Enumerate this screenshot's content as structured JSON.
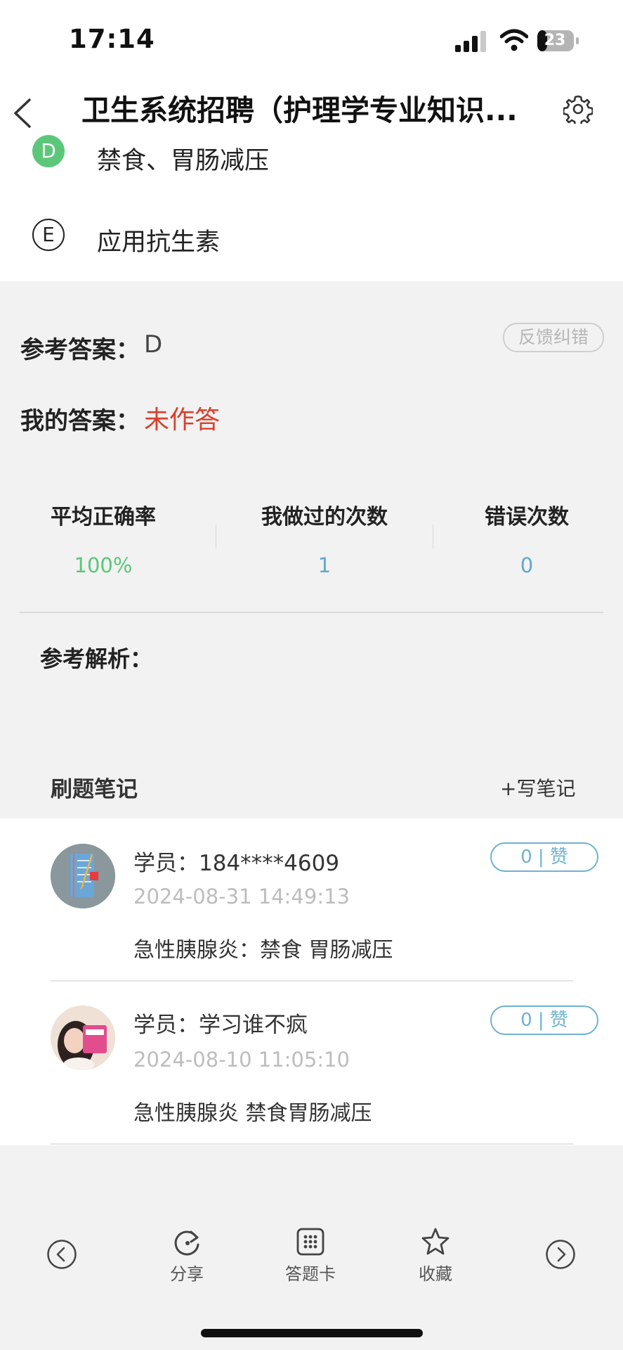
{
  "status_bar": {
    "time": "17:14",
    "battery_level": "23"
  },
  "nav": {
    "title": "卫生系统招聘（护理学专业知识..."
  },
  "options": [
    {
      "letter": "D",
      "text": "禁食、胃肠减压",
      "state": "correct"
    },
    {
      "letter": "E",
      "text": "应用抗生素",
      "state": "normal"
    }
  ],
  "answer": {
    "reference_label": "参考答案：",
    "reference_value": "D",
    "my_label": "我的答案：",
    "my_value": "未作答",
    "feedback_button": "反馈纠错"
  },
  "stats": [
    {
      "label": "平均正确率",
      "value": "100%",
      "color": "#5cc779"
    },
    {
      "label": "我做过的次数",
      "value": "1",
      "color": "#5ea8cc"
    },
    {
      "label": "错误次数",
      "value": "0",
      "color": "#5ea8cc"
    }
  ],
  "analysis": {
    "label": "参考解析："
  },
  "notes_section": {
    "title": "刷题笔记",
    "write_button": "+写笔记"
  },
  "notes": [
    {
      "user": "学员：184****4609",
      "time": "2024-08-31 14:49:13",
      "text": "急性胰腺炎：禁食 胃肠减压",
      "likes": "0 | 赞"
    },
    {
      "user": "学员：学习谁不疯",
      "time": "2024-08-10 11:05:10",
      "text": "急性胰腺炎 禁食胃肠减压",
      "likes": "0 | 赞"
    }
  ],
  "toolbar": {
    "share": "分享",
    "answer_card": "答题卡",
    "favorite": "收藏"
  },
  "colors": {
    "correct_green": "#5cc779",
    "wrong_red": "#d9402b",
    "accent_blue": "#6fb3cf"
  }
}
